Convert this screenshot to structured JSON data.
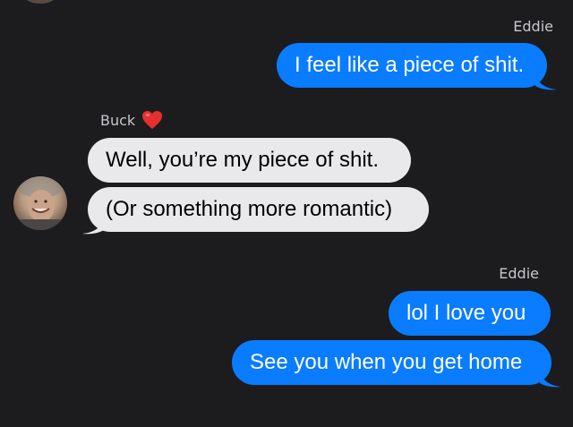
{
  "colors": {
    "background": "#1c1c1e",
    "outgoing_bubble": "#0a7cff",
    "incoming_bubble": "#e9e9eb",
    "sender_label": "#c7c7cc",
    "heart": "#e5302f"
  },
  "thread": {
    "group1": {
      "sender": "Eddie",
      "messages": [
        "I feel like a piece of shit."
      ]
    },
    "group2": {
      "sender": "Buck",
      "sender_icon": "red-heart-icon",
      "messages": [
        "Well, you’re my piece of shit.",
        "(Or something more romantic)"
      ]
    },
    "group3": {
      "sender": "Eddie",
      "messages": [
        "lol I love you",
        "See you when you get home"
      ]
    }
  }
}
